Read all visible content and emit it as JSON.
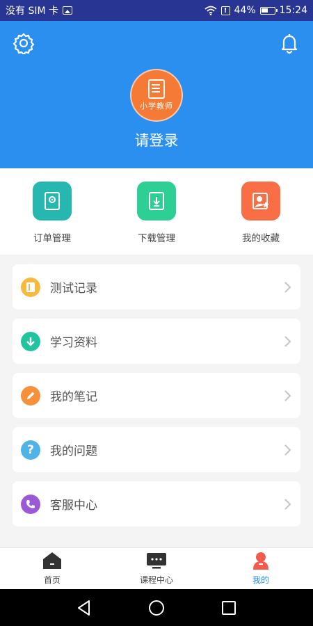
{
  "status_bar": {
    "carrier": "没有 SIM 卡",
    "battery": "44%",
    "time": "15:24"
  },
  "header": {
    "avatar_text": "小学教师",
    "login_text": "请登录"
  },
  "quick_actions": [
    {
      "label": "订单管理",
      "icon": "order-icon",
      "color": "#26b8b0"
    },
    {
      "label": "下载管理",
      "icon": "download-icon",
      "color": "#2ecf95"
    },
    {
      "label": "我的收藏",
      "icon": "favorite-icon",
      "color": "#fa6e45"
    }
  ],
  "menu_items": [
    {
      "label": "测试记录",
      "icon": "book-icon",
      "color": "#f7b940"
    },
    {
      "label": "学习资料",
      "icon": "download-circle-icon",
      "color": "#22c4a0"
    },
    {
      "label": "我的笔记",
      "icon": "pencil-icon",
      "color": "#f6913a"
    },
    {
      "label": "我的问题",
      "icon": "question-icon",
      "color": "#4fb3e8"
    },
    {
      "label": "客服中心",
      "icon": "phone-icon",
      "color": "#9b59d6"
    }
  ],
  "bottom_nav": [
    {
      "label": "首页",
      "icon": "home-icon",
      "active": false
    },
    {
      "label": "课程中心",
      "icon": "course-icon",
      "active": false
    },
    {
      "label": "我的",
      "icon": "profile-icon",
      "active": true
    }
  ],
  "colors": {
    "primary": "#2b8ff0",
    "active_nav_icon": "#f25a4c"
  }
}
